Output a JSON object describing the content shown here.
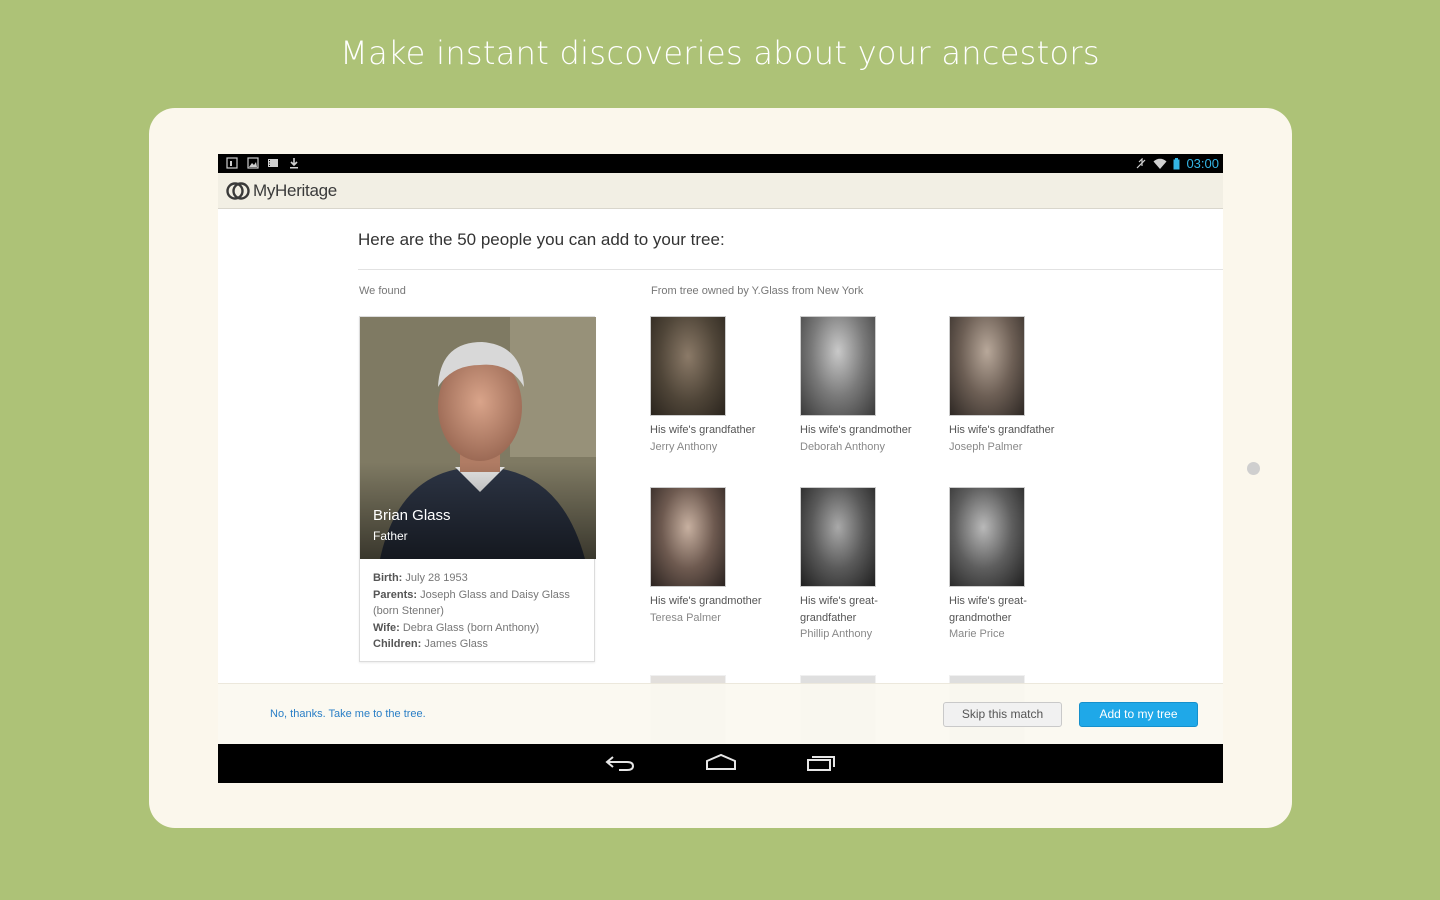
{
  "headline": "Make instant discoveries about your ancestors",
  "status_bar": {
    "time": "03:00",
    "left_icons": [
      "calendar-icon",
      "image-icon",
      "film-icon",
      "download-icon"
    ],
    "right_icons": [
      "mute-icon",
      "wifi-icon",
      "battery-icon"
    ]
  },
  "app": {
    "logo_text": "MyHeritage"
  },
  "main": {
    "heading": "Here are the 50 people you can add to your tree:",
    "we_found_label": "We found",
    "from_tree_label": "From tree owned by Y.Glass from New York"
  },
  "profile": {
    "name": "Brian Glass",
    "relation": "Father",
    "birth_label": "Birth:",
    "birth_value": "July 28 1953",
    "parents_label": "Parents:",
    "parents_value": "Joseph Glass and Daisy Glass (born Stenner)",
    "wife_label": "Wife:",
    "wife_value": "Debra Glass (born Anthony)",
    "children_label": "Children:",
    "children_value": "James Glass"
  },
  "people": [
    {
      "relation": "His wife's grandfather",
      "name": "Jerry Anthony"
    },
    {
      "relation": "His wife's grandmother",
      "name": "Deborah Anthony"
    },
    {
      "relation": "His wife's grandfather",
      "name": "Joseph Palmer"
    },
    {
      "relation": "His wife's grandmother",
      "name": "Teresa Palmer"
    },
    {
      "relation": "His wife's great-grandfather",
      "name": "Phillip Anthony"
    },
    {
      "relation": "His wife's great-grandmother",
      "name": "Marie Price"
    }
  ],
  "footer": {
    "no_thanks": "No, thanks. Take me to the tree.",
    "skip": "Skip this match",
    "add": "Add to my tree"
  },
  "colors": {
    "background": "#adc277",
    "accent": "#1fa8e8",
    "status_time": "#33b5e5",
    "link": "#2a7fc6"
  }
}
